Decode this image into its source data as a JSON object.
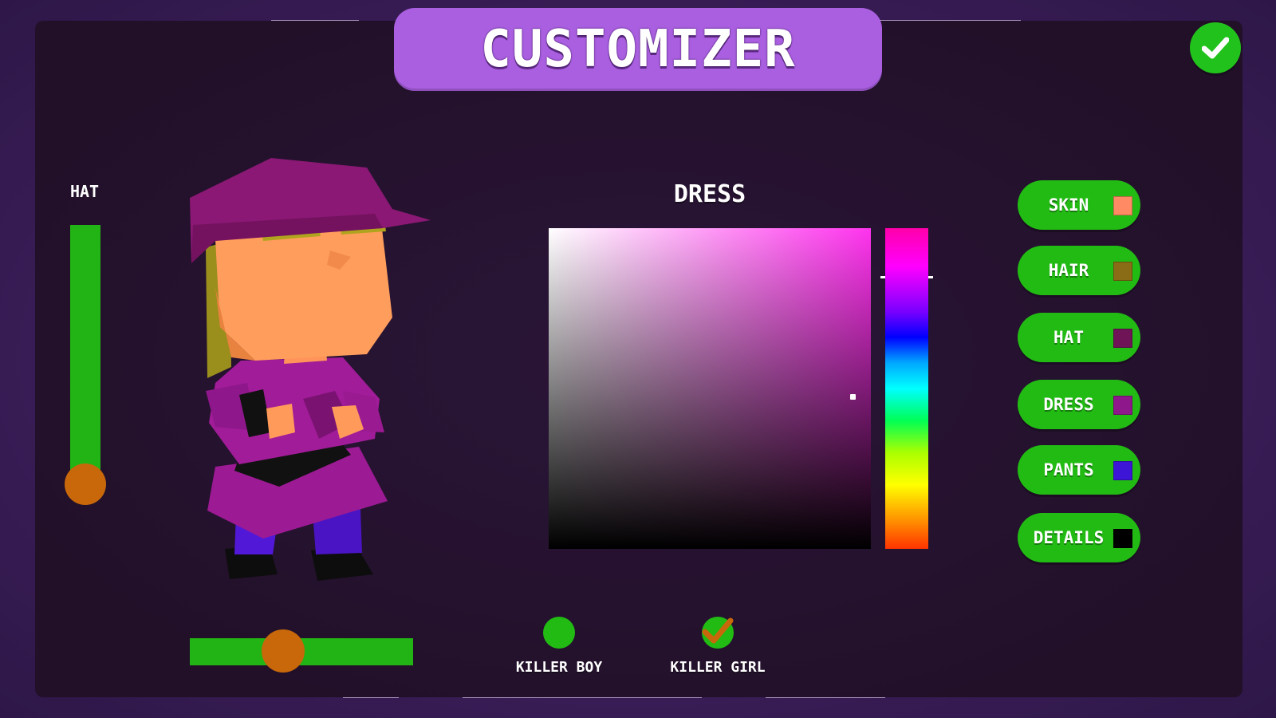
{
  "header": {
    "title": "CUSTOMIZER"
  },
  "confirm": {
    "icon": "checkmark-icon",
    "color": "#22c21c"
  },
  "hat_slider": {
    "label": "HAT",
    "value_fraction": 0.0
  },
  "rotation_slider": {
    "value_fraction": 0.4
  },
  "color_picker": {
    "label": "DRESS",
    "selected_hue_color": "#ff33ee"
  },
  "parts": [
    {
      "label": "SKIN",
      "swatch": "#ff8a63"
    },
    {
      "label": "HAIR",
      "swatch": "#8a6b16"
    },
    {
      "label": "HAT",
      "swatch": "#6e1457"
    },
    {
      "label": "DRESS",
      "swatch": "#8e178b"
    },
    {
      "label": "PANTS",
      "swatch": "#3d15d6"
    },
    {
      "label": "DETAILS",
      "swatch": "#000000"
    }
  ],
  "characters": [
    {
      "label": "KILLER BOY",
      "selected": false
    },
    {
      "label": "KILLER GIRL",
      "selected": true
    }
  ],
  "colors": {
    "accent_green": "#22bb14",
    "title_purple": "#a95fe0",
    "knob_orange": "#c8680a"
  }
}
